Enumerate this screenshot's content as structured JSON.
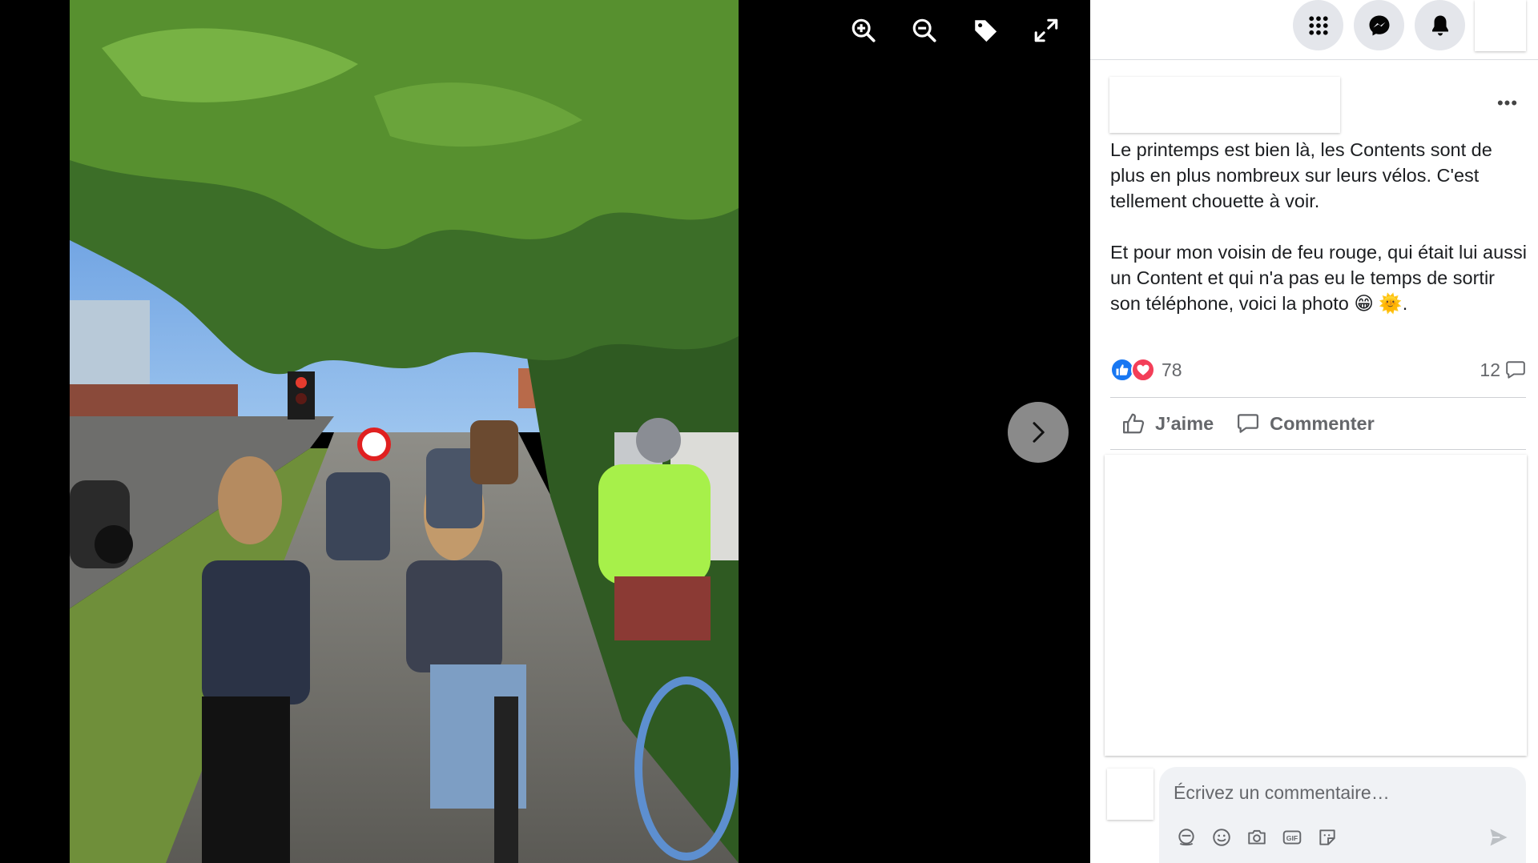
{
  "viewer": {
    "tools": [
      "zoom-in-icon",
      "zoom-out-icon",
      "tag-icon",
      "fullscreen-icon"
    ],
    "next_icon": "chevron-right-icon"
  },
  "topbar": {
    "icons": [
      "apps-grid-icon",
      "messenger-icon",
      "notifications-bell-icon"
    ]
  },
  "post": {
    "more_label": "•••",
    "paragraph_1": "Le printemps est bien là, les Contents sont de plus en plus nombreux sur leurs vélos. C'est tellement chouette à voir.",
    "paragraph_2": "Et pour mon voisin de feu rouge, qui était lui aussi un Content et qui n'a pas eu le temps de sortir son téléphone, voici la photo 😁 🌞."
  },
  "reactions": {
    "count": "78",
    "comments_count": "12",
    "types": [
      "like",
      "love"
    ]
  },
  "actions": {
    "like_label": "J’aime",
    "comment_label": "Commenter"
  },
  "composer": {
    "placeholder": "Écrivez un commentaire…",
    "tools": [
      "avatar-sticker-icon",
      "emoji-icon",
      "camera-icon",
      "gif-icon",
      "sticker-icon"
    ],
    "send_icon": "send-icon"
  },
  "colors": {
    "reaction_like": "#1877f2",
    "reaction_love": "#f33e58",
    "secondary_text": "#65676b",
    "icon_bg": "#e4e6eb"
  }
}
